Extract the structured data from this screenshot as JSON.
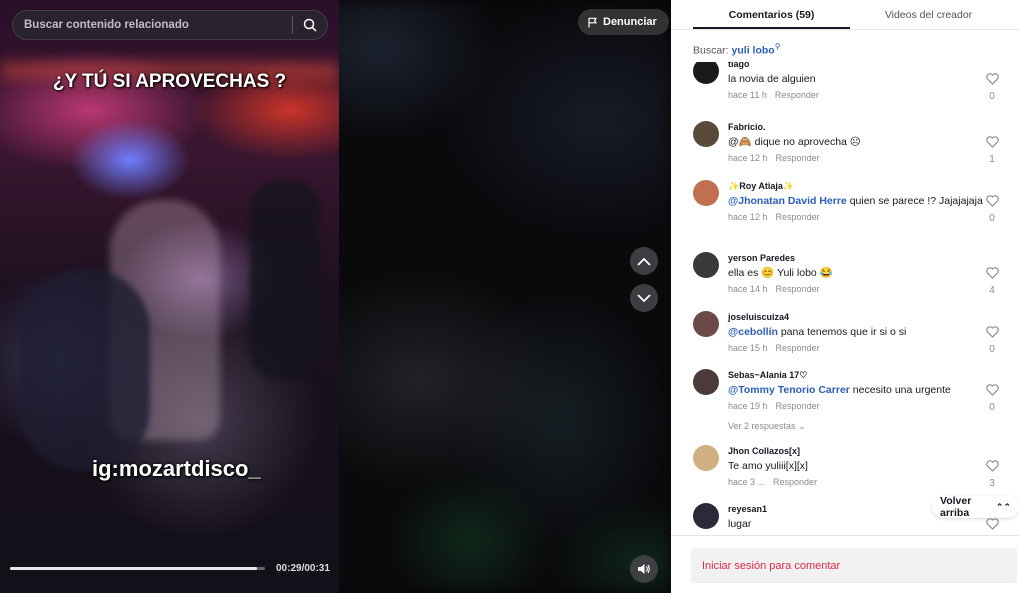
{
  "video": {
    "search_placeholder": "Buscar contenido relacionado",
    "caption_top": "¿Y TÚ SI APROVECHAS ?",
    "caption_bottom": "ig:mozartdisco_",
    "progress_fraction": 0.967,
    "timecode": "00:29/00:31",
    "report_label": "Denunciar"
  },
  "panel": {
    "tabs": [
      {
        "label": "Comentarios (59)",
        "active": true
      },
      {
        "label": "Videos del creador",
        "active": false
      }
    ],
    "search_label": "Buscar:",
    "search_keyword": "yuli lobo",
    "comments": [
      {
        "user": "tiago",
        "mention": "",
        "text": "la novia de alguien",
        "time": "hace 11 h",
        "reply": "Responder",
        "likes": "0"
      },
      {
        "user": "Fabricio.",
        "mention": "",
        "text": "@🙈 dique no aprovecha ☹",
        "time": "hace 12 h",
        "reply": "Responder",
        "likes": "1"
      },
      {
        "user": "✨Roy Atiaja✨",
        "mention": "@Jhonatan David Herre",
        "text": " quien se parece !? Jajajajaja",
        "time": "hace 12 h",
        "reply": "Responder",
        "likes": "0"
      },
      {
        "user": "yerson Paredes",
        "mention": "",
        "text": "ella es 😊 Yuli lobo 😂",
        "time": "hace 14 h",
        "reply": "Responder",
        "likes": "4"
      },
      {
        "user": "joseluiscuiza4",
        "mention": "@cebollín",
        "text": " pana tenemos que ir si o si",
        "time": "hace 15 h",
        "reply": "Responder",
        "likes": "0"
      },
      {
        "user": "Sebas~Alania 17♡",
        "mention": "@Tommy Tenorio Carrer",
        "text": " necesito una urgente",
        "time": "hace 19 h",
        "reply": "Responder",
        "likes": "0",
        "view_replies": "Ver 2 respuestas"
      },
      {
        "user": "Jhon Collazos[x]",
        "mention": "",
        "text": "Te amo yuliii[x][x]",
        "time": "hace 3 ...",
        "reply": "Responder",
        "likes": "3"
      },
      {
        "user": "reyesan1",
        "mention": "",
        "text": "lugar",
        "time": "",
        "reply": "",
        "likes": ""
      }
    ],
    "back_to_top": "Volver arriba",
    "login_prompt": "Iniciar sesión para comentar"
  }
}
